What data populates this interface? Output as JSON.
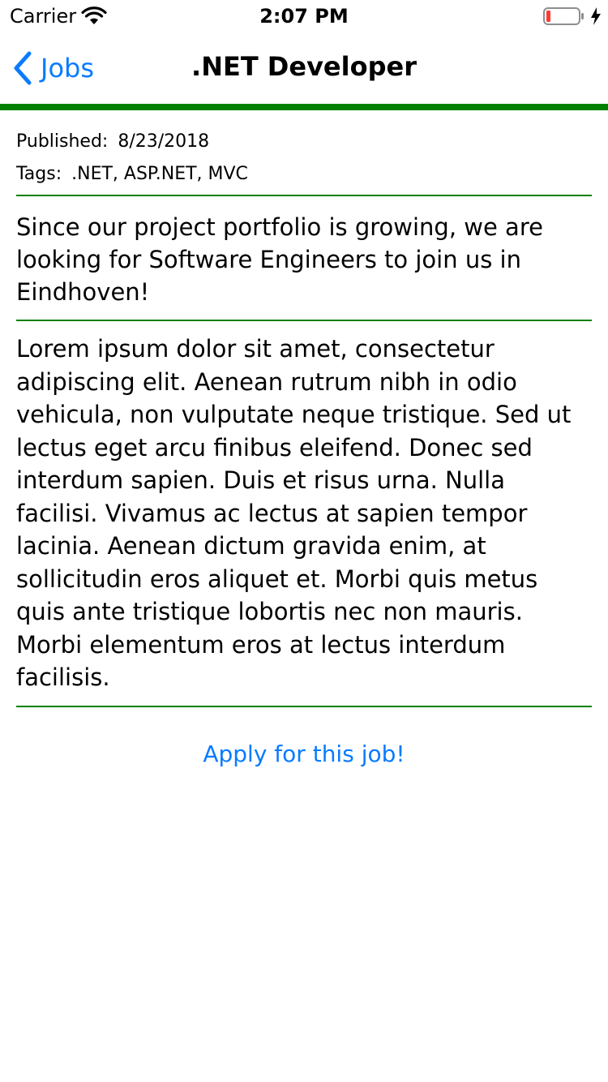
{
  "status_bar": {
    "carrier": "Carrier",
    "time": "2:07 PM",
    "icons": [
      "wifi-icon",
      "battery-icon",
      "charging-bolt-icon"
    ]
  },
  "nav": {
    "back_label": "Jobs",
    "title": ".NET Developer",
    "accent_color": "#008000",
    "link_color": "#0a7bff"
  },
  "job": {
    "published_label": "Published:",
    "published_value": "8/23/2018",
    "tags_label": "Tags:",
    "tags_value": ".NET, ASP.NET, MVC",
    "summary": "Since our project portfolio is growing, we are looking for Software Engineers to join us in Eindhoven!",
    "description": "Lorem ipsum dolor sit amet, consectetur adipiscing elit. Aenean rutrum nibh in odio vehicula, non vulputate neque tristique. Sed ut lectus eget arcu finibus eleifend. Donec sed interdum sapien. Duis et risus urna. Nulla facilisi. Vivamus ac lectus at sapien tempor lacinia. Aenean dictum gravida enim, at sollicitudin eros aliquet et. Morbi quis metus quis ante tristique lobortis nec non mauris. Morbi elementum eros at lectus interdum facilisis.",
    "apply_label": "Apply for this job!"
  }
}
